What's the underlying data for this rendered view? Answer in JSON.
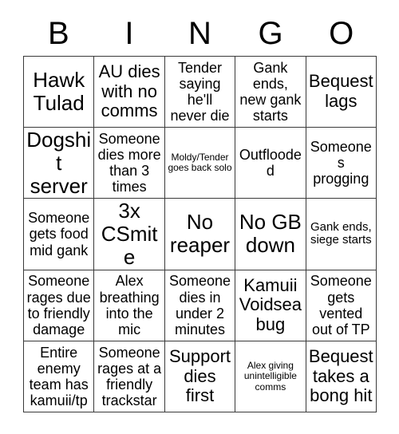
{
  "card": {
    "title": "BINGO",
    "header_letters": [
      "B",
      "I",
      "N",
      "G",
      "O"
    ],
    "colors": {
      "background": "#ffffff",
      "text": "#000000",
      "grid_line": "#3a3a3a"
    },
    "grid": {
      "columns": 5,
      "rows": 5,
      "cells": [
        {
          "text": "Hawk Tulad",
          "size": "fs-xl"
        },
        {
          "text": "AU dies with no comms",
          "size": "fs-lg"
        },
        {
          "text": "Tender saying he'll never die",
          "size": "fs-md"
        },
        {
          "text": "Gank ends, new gank starts",
          "size": "fs-md"
        },
        {
          "text": "Bequest lags",
          "size": "fs-lg"
        },
        {
          "text": "Dogshit server",
          "size": "fs-xl"
        },
        {
          "text": "Someone dies more than 3 times",
          "size": "fs-md"
        },
        {
          "text": "Moldy/Tender goes back solo",
          "size": "fs-xs"
        },
        {
          "text": "Outflooded",
          "size": "fs-md"
        },
        {
          "text": "Someones progging",
          "size": "fs-md"
        },
        {
          "text": "Someone gets food mid gank",
          "size": "fs-md"
        },
        {
          "text": "3x CSmite",
          "size": "fs-xl"
        },
        {
          "text": "No reaper",
          "size": "fs-xl"
        },
        {
          "text": "No GB down",
          "size": "fs-xl"
        },
        {
          "text": "Gank ends, siege starts",
          "size": "fs-sm"
        },
        {
          "text": "Someone rages due to friendly damage",
          "size": "fs-md"
        },
        {
          "text": "Alex breathing into the mic",
          "size": "fs-md"
        },
        {
          "text": "Someone dies in under 2 minutes",
          "size": "fs-md"
        },
        {
          "text": "Kamuii Voidsea bug",
          "size": "fs-lg"
        },
        {
          "text": "Someone gets vented out of TP",
          "size": "fs-md"
        },
        {
          "text": "Entire enemy team has kamuii/tp",
          "size": "fs-md"
        },
        {
          "text": "Someone rages at a friendly trackstar",
          "size": "fs-md"
        },
        {
          "text": "Support dies first",
          "size": "fs-lg"
        },
        {
          "text": "Alex giving unintelligible comms",
          "size": "fs-xs"
        },
        {
          "text": "Bequest takes a bong hit",
          "size": "fs-lg"
        }
      ]
    }
  }
}
